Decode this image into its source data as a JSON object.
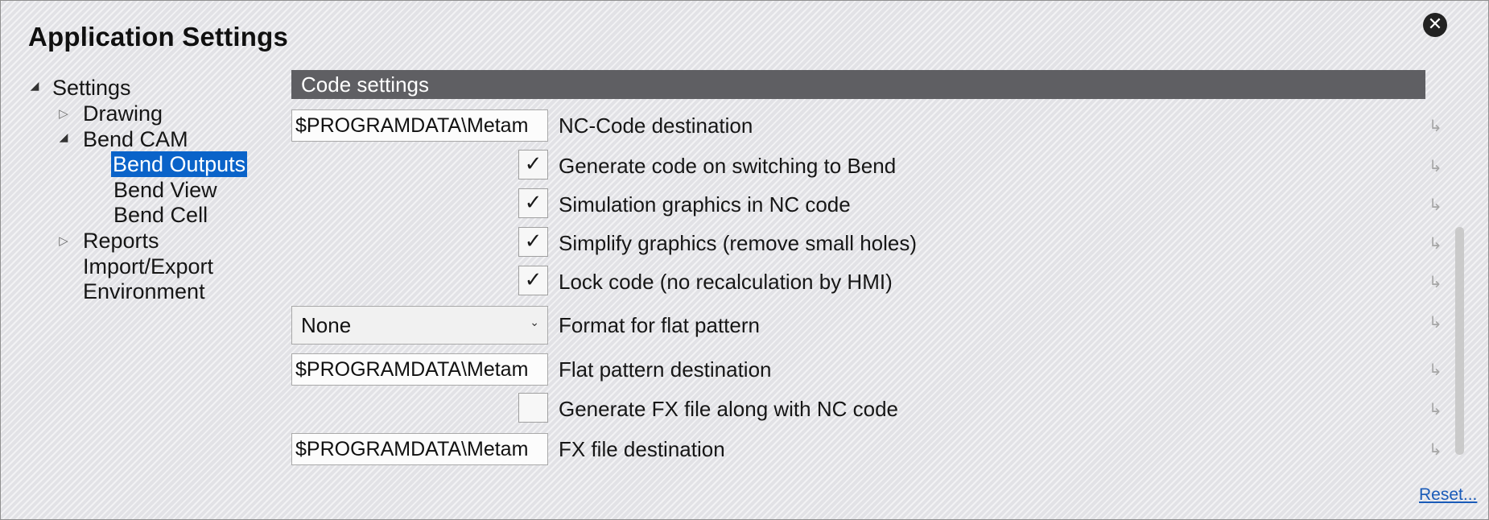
{
  "window": {
    "title": "Application Settings",
    "close_glyph": "✕",
    "reset_link": "Reset..."
  },
  "tree": {
    "root": {
      "label": "Settings",
      "expanded": true
    },
    "items": [
      {
        "label": "Drawing",
        "expanded": false
      },
      {
        "label": "Bend CAM",
        "expanded": true
      },
      {
        "label": "Bend Outputs",
        "selected": true
      },
      {
        "label": "Bend View"
      },
      {
        "label": "Bend Cell"
      },
      {
        "label": "Reports",
        "expanded": false
      },
      {
        "label": "Import/Export"
      },
      {
        "label": "Environment"
      }
    ],
    "glyphs": {
      "expanded": "◢",
      "collapsed": "▷"
    }
  },
  "panel": {
    "section_title": "Code settings",
    "rows": [
      {
        "type": "text",
        "value": "$PROGRAMDATA\\Metam",
        "label": "NC-Code destination"
      },
      {
        "type": "checkbox",
        "checked": true,
        "label": "Generate code on switching to Bend"
      },
      {
        "type": "checkbox",
        "checked": true,
        "label": "Simulation graphics in NC code"
      },
      {
        "type": "checkbox",
        "checked": true,
        "label": "Simplify graphics (remove small holes)"
      },
      {
        "type": "checkbox",
        "checked": true,
        "label": "Lock code (no recalculation by HMI)"
      },
      {
        "type": "select",
        "value": "None",
        "label": "Format for flat pattern"
      },
      {
        "type": "text",
        "value": "$PROGRAMDATA\\Metam",
        "label": "Flat pattern destination"
      },
      {
        "type": "checkbox",
        "checked": false,
        "label": "Generate FX file along with NC code"
      },
      {
        "type": "text",
        "value": "$PROGRAMDATA\\Metam",
        "label": "FX file destination"
      }
    ],
    "check_glyph": "✓",
    "select_caret_glyph": "⌄",
    "reset_row_glyph": "↳"
  },
  "icons": {
    "close": "close-icon",
    "tree_expanded": "triangle-expanded-icon",
    "tree_collapsed": "triangle-collapsed-icon",
    "checkmark": "checkmark-icon",
    "row_reset": "reset-arrow-icon"
  },
  "colors": {
    "selection": "#0a63c9",
    "section_header": "#5f5f63",
    "link": "#1a5bb8"
  }
}
